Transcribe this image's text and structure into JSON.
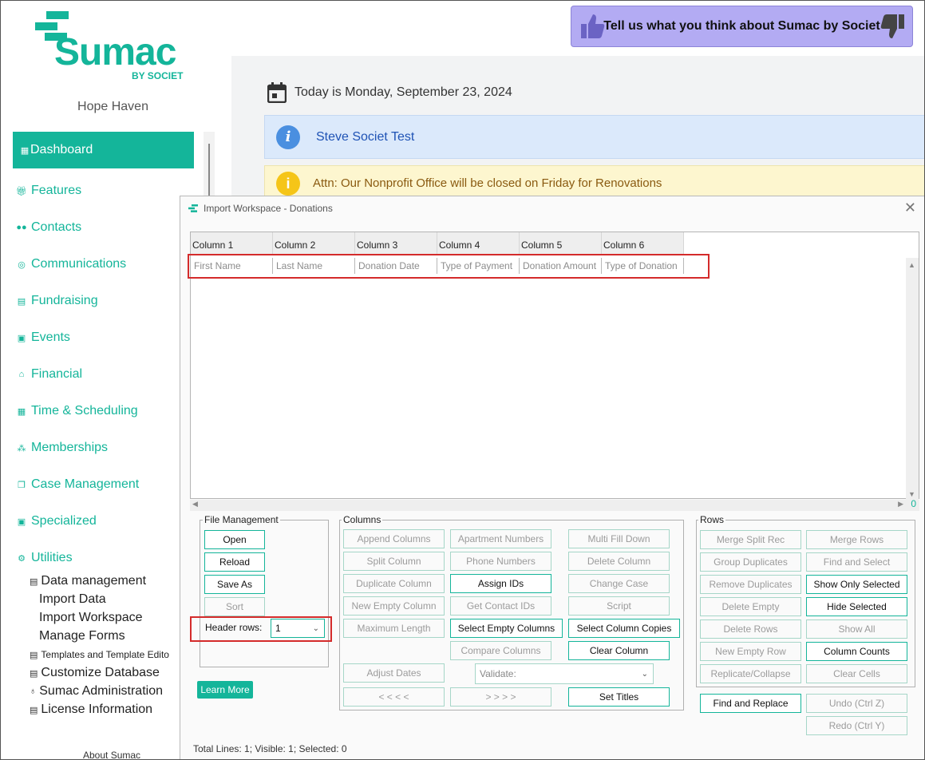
{
  "brand": {
    "logo_text": "Sumac",
    "logo_sub": "BY SOCIET",
    "accent": "#14b59a"
  },
  "org_name": "Hope Haven",
  "feedback": {
    "text": "Tell us what you think about Sumac by Societ"
  },
  "nav": {
    "active": "Dashboard",
    "items": [
      "Features",
      "Contacts",
      "Communications",
      "Fundraising",
      "Events",
      "Financial",
      "Time & Scheduling",
      "Memberships",
      "Case Management",
      "Specialized",
      "Utilities"
    ],
    "sub_items": [
      "Data management",
      "Import Data",
      "Import Workspace",
      "Manage Forms",
      "Templates and Template Edito",
      "Customize Database",
      "Sumac Administration",
      "License Information"
    ],
    "about": "About Sumac"
  },
  "main": {
    "date_text": "Today is Monday, September 23, 2024",
    "info_text": "Steve Societ Test",
    "warn_text": "Attn: Our Nonprofit Office will be closed on Friday for Renovations"
  },
  "dialog": {
    "title": "Import Workspace - Donations",
    "columns": [
      "Column 1",
      "Column 2",
      "Column 3",
      "Column 4",
      "Column 5",
      "Column 6"
    ],
    "row1": [
      "First Name",
      "Last Name",
      "Donation Date",
      "Type of Payment",
      "Donation Amount",
      "Type of Donation"
    ],
    "hscroll_count": "0",
    "file_management": {
      "label": "File Management",
      "open": "Open",
      "reload": "Reload",
      "save_as": "Save As",
      "sort": "Sort",
      "header_rows_label": "Header rows:",
      "header_rows_value": "1",
      "learn_more": "Learn More"
    },
    "columns_group": {
      "label": "Columns",
      "append": "Append Columns",
      "apartment": "Apartment Numbers",
      "multi_fill": "Multi Fill Down",
      "split": "Split Column",
      "phone": "Phone Numbers",
      "delete_col": "Delete Column",
      "duplicate": "Duplicate Column",
      "assign_ids": "Assign IDs",
      "change_case": "Change Case",
      "new_empty": "New Empty Column",
      "get_contact": "Get Contact IDs",
      "script": "Script",
      "max_len": "Maximum Length",
      "select_empty": "Select Empty Columns",
      "select_copies": "Select Column Copies",
      "compare": "Compare Columns",
      "clear_col": "Clear Column",
      "adjust_dates": "Adjust Dates",
      "validate": "Validate:",
      "prev": "< < < <",
      "next": "> > > >",
      "set_titles": "Set Titles"
    },
    "rows_group": {
      "label": "Rows",
      "merge_split": "Merge Split Rec",
      "merge_rows": "Merge Rows",
      "group_dup": "Group Duplicates",
      "find_select": "Find and Select",
      "remove_dup": "Remove Duplicates",
      "show_only": "Show Only Selected",
      "delete_empty": "Delete Empty",
      "hide_selected": "Hide Selected",
      "delete_rows": "Delete Rows",
      "show_all": "Show All",
      "new_empty_row": "New Empty Row",
      "column_counts": "Column Counts",
      "replicate": "Replicate/Collapse",
      "clear_cells": "Clear Cells"
    },
    "find_replace": "Find and Replace",
    "undo": "Undo (Ctrl Z)",
    "redo": "Redo (Ctrl Y)",
    "status": "Total Lines: 1; Visible: 1; Selected: 0"
  }
}
